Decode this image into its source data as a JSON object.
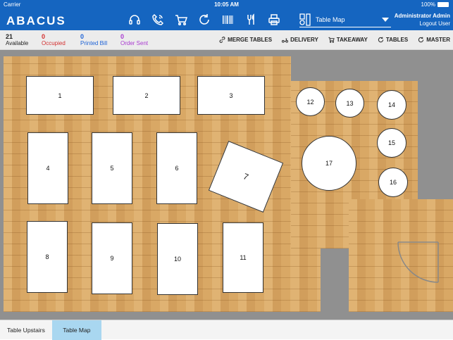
{
  "status_bar": {
    "carrier": "Carrier",
    "time": "10:05 AM",
    "battery": "100%"
  },
  "header": {
    "logo": "ABACUS",
    "toolbar_icons": [
      "headset-icon",
      "phone-icon",
      "cart-icon",
      "refresh-icon",
      "barcode-icon",
      "utensils-icon",
      "printer-icon"
    ],
    "view_select": "Table Map",
    "user_name": "Administrator Admin",
    "logout": "Logout User"
  },
  "stats": [
    {
      "count": "21",
      "label": "Available",
      "color": "#222222"
    },
    {
      "count": "0",
      "label": "Occupied",
      "color": "#d32f2f"
    },
    {
      "count": "0",
      "label": "Printed Bill",
      "color": "#1e63d6"
    },
    {
      "count": "0",
      "label": "Order Sent",
      "color": "#a93ad0"
    }
  ],
  "actions": [
    "MERGE TABLES",
    "DELIVERY",
    "TAKEAWAY",
    "TABLES",
    "MASTER"
  ],
  "tables": [
    "1",
    "2",
    "3",
    "4",
    "5",
    "6",
    "7",
    "8",
    "9",
    "10",
    "11",
    "12",
    "13",
    "14",
    "15",
    "16",
    "17"
  ],
  "bottom_tabs": [
    "Table Upstairs",
    "Table Map"
  ],
  "colors": {
    "header": "#1565c0",
    "floor": "#d9a865",
    "wall": "#909090",
    "active_tab": "#a9d7f0"
  }
}
